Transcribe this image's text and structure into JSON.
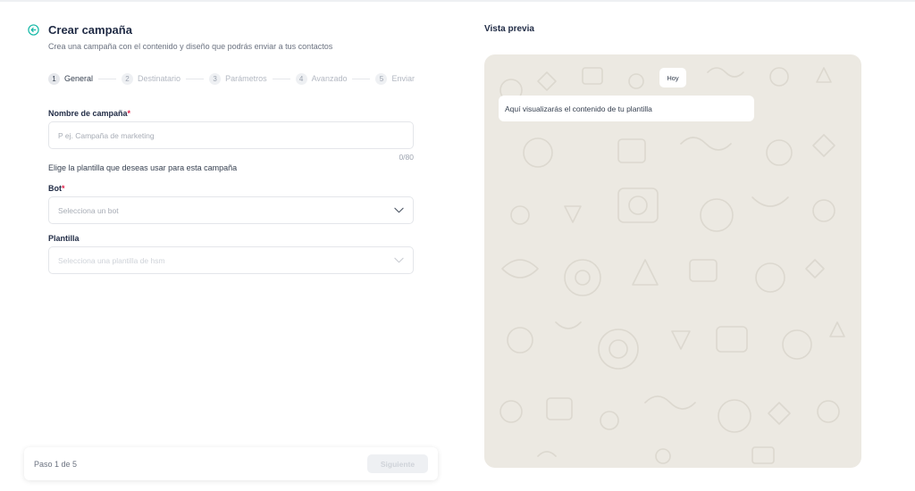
{
  "header": {
    "title": "Crear campaña",
    "subtitle": "Crea una campaña con el contenido y diseño que podrás enviar a tus contactos"
  },
  "stepper": {
    "steps": [
      {
        "num": "1",
        "label": "General",
        "active": true
      },
      {
        "num": "2",
        "label": "Destinatario",
        "active": false
      },
      {
        "num": "3",
        "label": "Parámetros",
        "active": false
      },
      {
        "num": "4",
        "label": "Avanzado",
        "active": false
      },
      {
        "num": "5",
        "label": "Enviar",
        "active": false
      }
    ]
  },
  "form": {
    "campaign_name": {
      "label": "Nombre de campaña",
      "required_mark": "*",
      "placeholder": "P ej. Campaña de marketing",
      "value": "",
      "counter": "0/80"
    },
    "helper_text": "Elige la plantilla que deseas usar para esta campaña",
    "bot": {
      "label": "Bot",
      "required_mark": "*",
      "placeholder": "Selecciona un bot"
    },
    "template": {
      "label": "Plantilla",
      "placeholder": "Selecciona una plantilla de hsm",
      "disabled": true
    }
  },
  "footer": {
    "step_text": "Paso 1 de 5",
    "next_label": "Siguiente",
    "next_disabled": true
  },
  "preview": {
    "title": "Vista previa",
    "day_chip": "Hoy",
    "message": "Aquí visualizarás el contenido de tu plantilla"
  },
  "colors": {
    "accent": "#14b8a6",
    "required": "#e11d48",
    "chat_bg": "#ece9e2"
  },
  "icons": {
    "back": "arrow-left-circle-icon",
    "dropdown": "chevron-down-icon"
  }
}
